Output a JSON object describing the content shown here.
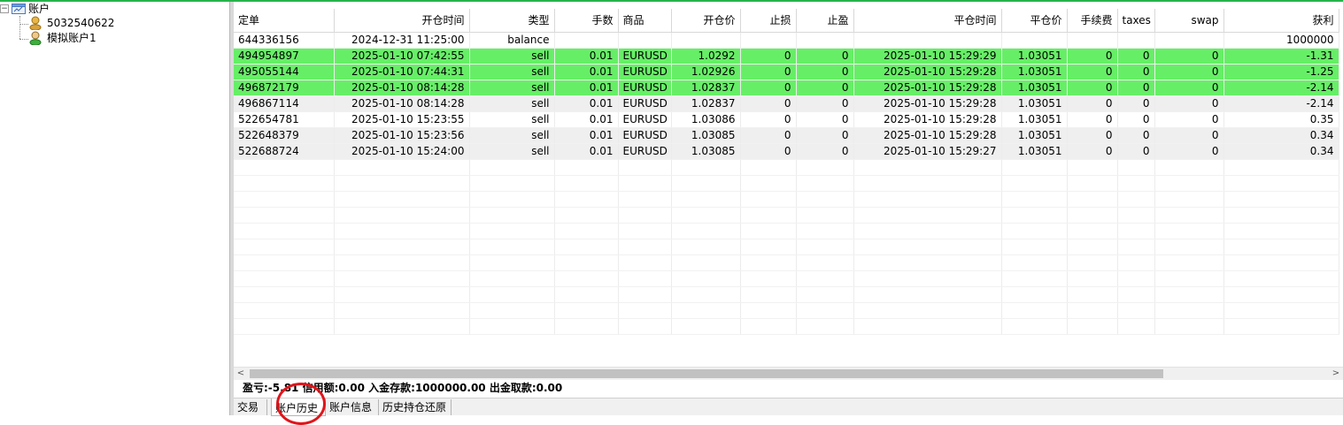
{
  "tree": {
    "root_label": "账户",
    "toggle_symbol": "−",
    "accounts": [
      {
        "label": "5032540622",
        "icon": "coin-user-icon"
      },
      {
        "label": "模拟账户1",
        "icon": "green-user-icon"
      }
    ]
  },
  "colors": {
    "highlight_row": "#66ef66",
    "alt_row": "#efefef",
    "annotation_circle": "#e0151b"
  },
  "table": {
    "columns": [
      "定单",
      "开仓时间",
      "类型",
      "手数",
      "商品",
      "开仓价",
      "止损",
      "止盈",
      "平仓时间",
      "平仓价",
      "手续费",
      "taxes",
      "swap",
      "获利"
    ],
    "rows": [
      {
        "cells": [
          "644336156",
          "2024-12-31 11:25:00",
          "balance",
          "",
          "",
          "",
          "",
          "",
          "",
          "",
          "",
          "",
          "",
          "1000000"
        ],
        "style": "normal"
      },
      {
        "cells": [
          "494954897",
          "2025-01-10 07:42:55",
          "sell",
          "0.01",
          "EURUSD",
          "1.0292",
          "0",
          "0",
          "2025-01-10 15:29:29",
          "1.03051",
          "0",
          "0",
          "0",
          "-1.31"
        ],
        "style": "hl"
      },
      {
        "cells": [
          "495055144",
          "2025-01-10 07:44:31",
          "sell",
          "0.01",
          "EURUSD",
          "1.02926",
          "0",
          "0",
          "2025-01-10 15:29:28",
          "1.03051",
          "0",
          "0",
          "0",
          "-1.25"
        ],
        "style": "hl"
      },
      {
        "cells": [
          "496872179",
          "2025-01-10 08:14:28",
          "sell",
          "0.01",
          "EURUSD",
          "1.02837",
          "0",
          "0",
          "2025-01-10 15:29:28",
          "1.03051",
          "0",
          "0",
          "0",
          "-2.14"
        ],
        "style": "hl"
      },
      {
        "cells": [
          "496867114",
          "2025-01-10 08:14:28",
          "sell",
          "0.01",
          "EURUSD",
          "1.02837",
          "0",
          "0",
          "2025-01-10 15:29:28",
          "1.03051",
          "0",
          "0",
          "0",
          "-2.14"
        ],
        "style": "alt"
      },
      {
        "cells": [
          "522654781",
          "2025-01-10 15:23:55",
          "sell",
          "0.01",
          "EURUSD",
          "1.03086",
          "0",
          "0",
          "2025-01-10 15:29:28",
          "1.03051",
          "0",
          "0",
          "0",
          "0.35"
        ],
        "style": "normal"
      },
      {
        "cells": [
          "522648379",
          "2025-01-10 15:23:56",
          "sell",
          "0.01",
          "EURUSD",
          "1.03085",
          "0",
          "0",
          "2025-01-10 15:29:28",
          "1.03051",
          "0",
          "0",
          "0",
          "0.34"
        ],
        "style": "alt"
      },
      {
        "cells": [
          "522688724",
          "2025-01-10 15:24:00",
          "sell",
          "0.01",
          "EURUSD",
          "1.03085",
          "0",
          "0",
          "2025-01-10 15:29:27",
          "1.03051",
          "0",
          "0",
          "0",
          "0.34"
        ],
        "style": "alt"
      }
    ]
  },
  "scrollbar": {
    "left_arrow": "<",
    "right_arrow": ">"
  },
  "summary": "盈亏:-5.81 信用额:0.00 入金存款:1000000.00 出金取款:0.00",
  "tabs": [
    {
      "label": "交易"
    },
    {
      "label": "账户历史",
      "active": true
    },
    {
      "label": "账户信息"
    },
    {
      "label": "历史持仓还原"
    }
  ]
}
